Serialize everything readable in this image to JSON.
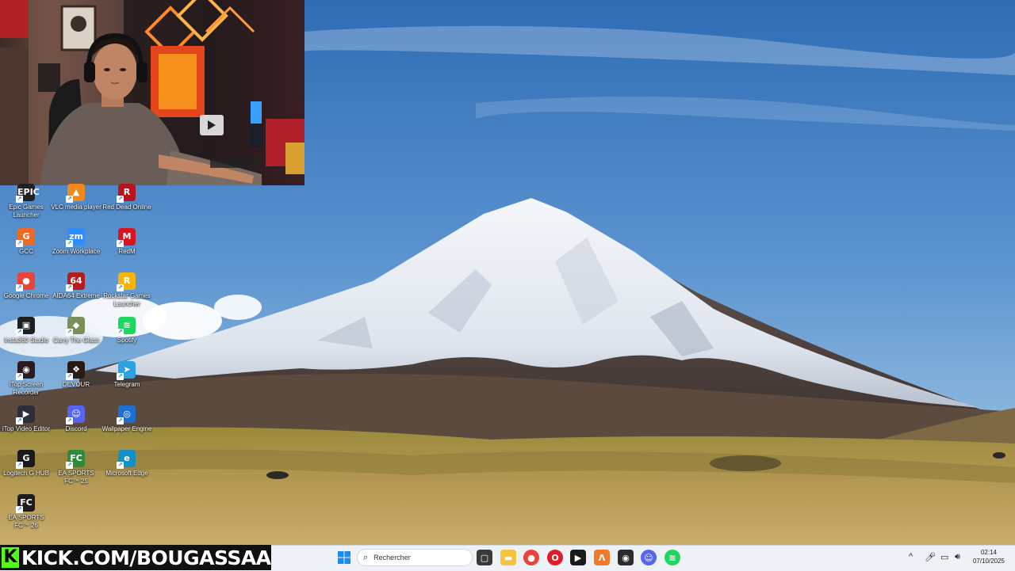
{
  "desktop": {
    "icons": [
      {
        "label": "Epic Games Launcher",
        "icon": "epic-games-icon",
        "bg": "#222222",
        "glyph": "EPIC"
      },
      {
        "label": "VLC media player",
        "icon": "vlc-icon",
        "bg": "#f08a1c",
        "glyph": "▲"
      },
      {
        "label": "Red Dead Online",
        "icon": "red-dead-online-icon",
        "bg": "#b8141b",
        "glyph": "R"
      },
      {
        "label": "GCC",
        "icon": "gcc-icon",
        "bg": "#ef6a22",
        "glyph": "G"
      },
      {
        "label": "Zoom Workplace",
        "icon": "zoom-icon",
        "bg": "#2d8cff",
        "glyph": "zm"
      },
      {
        "label": "RedM",
        "icon": "redm-icon",
        "bg": "#d7141f",
        "glyph": "M"
      },
      {
        "label": "Google Chrome",
        "icon": "chrome-icon",
        "bg": "#e9433a",
        "glyph": "●"
      },
      {
        "label": "AIDA64 Extreme",
        "icon": "aida64-icon",
        "bg": "#b51d1d",
        "glyph": "64"
      },
      {
        "label": "Rockstar Games Launcher",
        "icon": "rockstar-icon",
        "bg": "#f5b50c",
        "glyph": "R"
      },
      {
        "label": "Insta360 Studio",
        "icon": "insta360-icon",
        "bg": "#1e1e1e",
        "glyph": "▣"
      },
      {
        "label": "Carry The Glass",
        "icon": "carry-the-glass-icon",
        "bg": "#7a8f5a",
        "glyph": "◆"
      },
      {
        "label": "Spotify",
        "icon": "spotify-icon",
        "bg": "#1ed760",
        "glyph": "≋"
      },
      {
        "label": "iTop Screen Recorder",
        "icon": "itop-screen-recorder-icon",
        "bg": "#2b1a20",
        "glyph": "◉"
      },
      {
        "label": "DEVOUR",
        "icon": "devour-icon",
        "bg": "#2a1a14",
        "glyph": "❖"
      },
      {
        "label": "Telegram",
        "icon": "telegram-icon",
        "bg": "#2aa3e0",
        "glyph": "➤"
      },
      {
        "label": "iTop Video Editor",
        "icon": "itop-video-editor-icon",
        "bg": "#2e2e3a",
        "glyph": "▶"
      },
      {
        "label": "Discord",
        "icon": "discord-icon",
        "bg": "#5865f2",
        "glyph": "☺"
      },
      {
        "label": "Wallpaper Engine",
        "icon": "wallpaper-engine-icon",
        "bg": "#1c6fd0",
        "glyph": "◎"
      },
      {
        "label": "Logitech G HUB",
        "icon": "logitech-ghub-icon",
        "bg": "#1a1a1a",
        "glyph": "G"
      },
      {
        "label": "EA SPORTS FC™ 25",
        "icon": "ea-fc25-icon",
        "bg": "#2f8a3a",
        "glyph": "FC"
      },
      {
        "label": "Microsoft Edge",
        "icon": "edge-icon",
        "bg": "#1590c7",
        "glyph": "e"
      },
      {
        "label": "EA SPORTS FC™ 26",
        "icon": "ea-fc26-icon",
        "bg": "#1c1c1c",
        "glyph": "FC"
      }
    ]
  },
  "stream": {
    "brand_k": "K",
    "brand_url": "KICK.COM/BOUGASSAA",
    "brand_color": "#53fc18"
  },
  "taskbar": {
    "start_icon": "windows-start-icon",
    "search_placeholder": "Rechercher",
    "apps": [
      {
        "name": "task-view-icon",
        "bg": "#3a3a3a",
        "glyph": "▢"
      },
      {
        "name": "file-explorer-icon",
        "bg": "#f4c542",
        "glyph": "▬"
      },
      {
        "name": "chrome-taskbar-icon",
        "bg": "#e9433a",
        "glyph": "●"
      },
      {
        "name": "opera-icon",
        "bg": "#e01c2a",
        "glyph": "O"
      },
      {
        "name": "terminal-app-icon",
        "bg": "#1a1a1a",
        "glyph": "▶"
      },
      {
        "name": "orange-app-icon",
        "bg": "#f07a2a",
        "glyph": "Λ"
      },
      {
        "name": "obs-icon",
        "bg": "#2c2c2c",
        "glyph": "◉"
      },
      {
        "name": "discord-taskbar-icon",
        "bg": "#5865f2",
        "glyph": "☺"
      },
      {
        "name": "spotify-taskbar-icon",
        "bg": "#1ed760",
        "glyph": "≋"
      }
    ],
    "tray": {
      "chevron": "^",
      "time": "02:14",
      "date": "07/10/2025"
    }
  }
}
